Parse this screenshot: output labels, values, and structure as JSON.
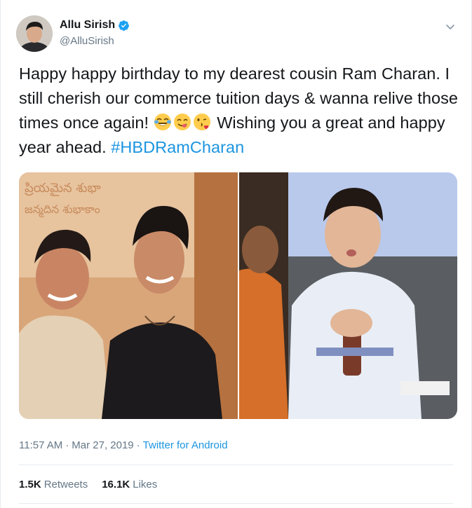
{
  "user": {
    "display_name": "Allu Sirish",
    "handle": "@AlluSirish",
    "verified": true
  },
  "tweet": {
    "text_part1": "Happy happy birthday to my dearest cousin Ram Charan. I still cherish our commerce tuition days & wanna relive those times once again! ",
    "emojis": [
      "face-with-tears-of-joy-emoji",
      "face-savoring-food-emoji",
      "face-blowing-kiss-emoji"
    ],
    "text_part2": " Wishing you a great and happy year ahead. ",
    "hashtag": "#HBDRamCharan"
  },
  "media": {
    "photos": [
      "photo-two-young-men",
      "photo-child-with-bottle"
    ]
  },
  "meta": {
    "time": "11:57 AM",
    "separator": "·",
    "date": "Mar 27, 2019",
    "source": "Twitter for Android"
  },
  "stats": {
    "retweets_count": "1.5K",
    "retweets_label": "Retweets",
    "likes_count": "16.1K",
    "likes_label": "Likes"
  },
  "colors": {
    "link": "#1b95e0",
    "secondary_text": "#657786",
    "primary_text": "#14171a",
    "border": "#e6ecf0",
    "verified_badge": "#1da1f2"
  },
  "icons": {
    "verified": "verified-badge-icon",
    "caret": "chevron-down-icon"
  }
}
